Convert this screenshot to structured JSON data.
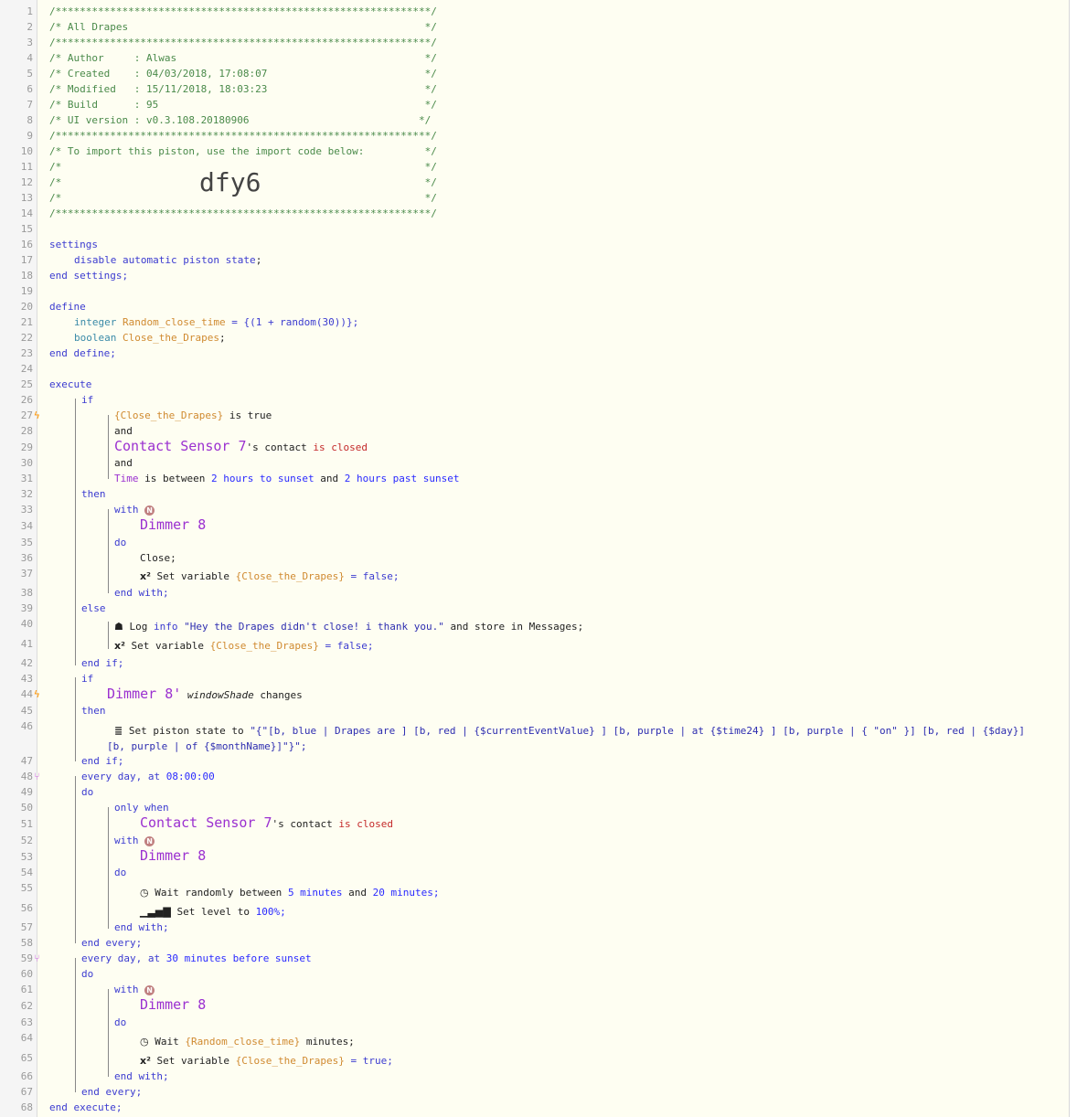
{
  "header": {
    "title_line": "/* All Drapes                                                 */",
    "author": "/* Author     : Alwas                                         */",
    "created": "/* Created    : 04/03/2018, 17:08:07                          */",
    "modified": "/* Modified   : 15/11/2018, 18:03:23                          */",
    "build": "/* Build      : 95                                            */",
    "ui_version": "/* UI version : v0.3.108.20180906                            */",
    "import_note": "/* To import this piston, use the import code below:          */",
    "blank": "/*                                                            */",
    "stars": "/**************************************************************/",
    "import_code": "dfy6"
  },
  "code": {
    "settings": "settings",
    "disable": "disable automatic piston state",
    "end_settings": "end settings;",
    "define": "define",
    "integer": "integer",
    "var_random": "Random_close_time",
    "random_expr": "= {(1 + random(30))};",
    "boolean": "boolean",
    "var_close": "Close_the_Drapes",
    "end_define": "end define;",
    "execute": "execute",
    "if": "if",
    "close_var_braced": "{Close_the_Drapes}",
    "is_true": "is true",
    "and": "and",
    "contact_sensor": "Contact Sensor 7",
    "s_contact": "'s contact",
    "is_closed": "is closed",
    "time": "Time",
    "is_between": "is between",
    "two_hours_to_sunset": "2 hours to sunset",
    "and_word": "and",
    "two_hours_past_sunset": "2 hours past sunset",
    "then": "then",
    "with": "with",
    "dimmer": "Dimmer 8",
    "do": "do",
    "close_cmd": "Close;",
    "set_variable": "Set variable",
    "eq_false": "= false;",
    "eq_true": "= true;",
    "end_with": "end with;",
    "else": "else",
    "log": "Log",
    "info": "info",
    "log_message": "\"Hey the Drapes didn't close! i thank you.\"",
    "store_messages": "and store in Messages;",
    "end_if": "end if;",
    "dimmer_apos": "Dimmer 8'",
    "windowshade": "windowShade",
    "changes": "changes",
    "set_piston_state": "Set piston state to",
    "piston_state_1": "\"{\"[b, blue | Drapes are ] [b, red | {$currentEventValue} ] [b, purple | at {$time24} ] [b, purple | { \"on\" }] [b, red | {$day}]",
    "piston_state_2": "[b, purple | of {$monthName}]\"}\";",
    "every_day_at": "every day, at",
    "time_0800": "08:00:00",
    "only_when": "only when",
    "wait_randomly": "Wait randomly between",
    "five_minutes": "5 minutes",
    "twenty_minutes": "20 minutes;",
    "set_level": "Set level to",
    "level_value": "100%;",
    "end_every": "end every;",
    "every_day_at_30": "every day, at",
    "thirty_minutes_before": "30 minutes",
    "before_sunset": "before sunset",
    "wait": "Wait",
    "random_var_braced": "{Random_close_time}",
    "minutes": "minutes;",
    "end_execute": "end execute;",
    "badge_letter": "N",
    "squared_icon": "x²"
  },
  "gutter": {
    "line_numbers": [
      "1",
      "2",
      "3",
      "4",
      "5",
      "6",
      "7",
      "8",
      "9",
      "10",
      "11",
      "12",
      "13",
      "14",
      "15",
      "16",
      "17",
      "18",
      "19",
      "20",
      "21",
      "22",
      "23",
      "24",
      "25",
      "26",
      "27",
      "28",
      "29",
      "30",
      "31",
      "32",
      "33",
      "34",
      "35",
      "36",
      "37",
      "38",
      "39",
      "40",
      "41",
      "42",
      "43",
      "44",
      "45",
      "46",
      "47",
      "48",
      "49",
      "50",
      "51",
      "52",
      "53",
      "54",
      "55",
      "56",
      "57",
      "58",
      "59",
      "60",
      "61",
      "62",
      "63",
      "64",
      "65",
      "66",
      "67",
      "68"
    ],
    "trigger_glyph": "ϟ",
    "timer_glyph": "⑂"
  },
  "colors": {
    "background": "#fefef2",
    "device": "#9b30d0",
    "keyword": "#3b3bd0",
    "variable": "#d08a30",
    "comment": "#4a8a4a",
    "red_value": "#c42a2a"
  }
}
